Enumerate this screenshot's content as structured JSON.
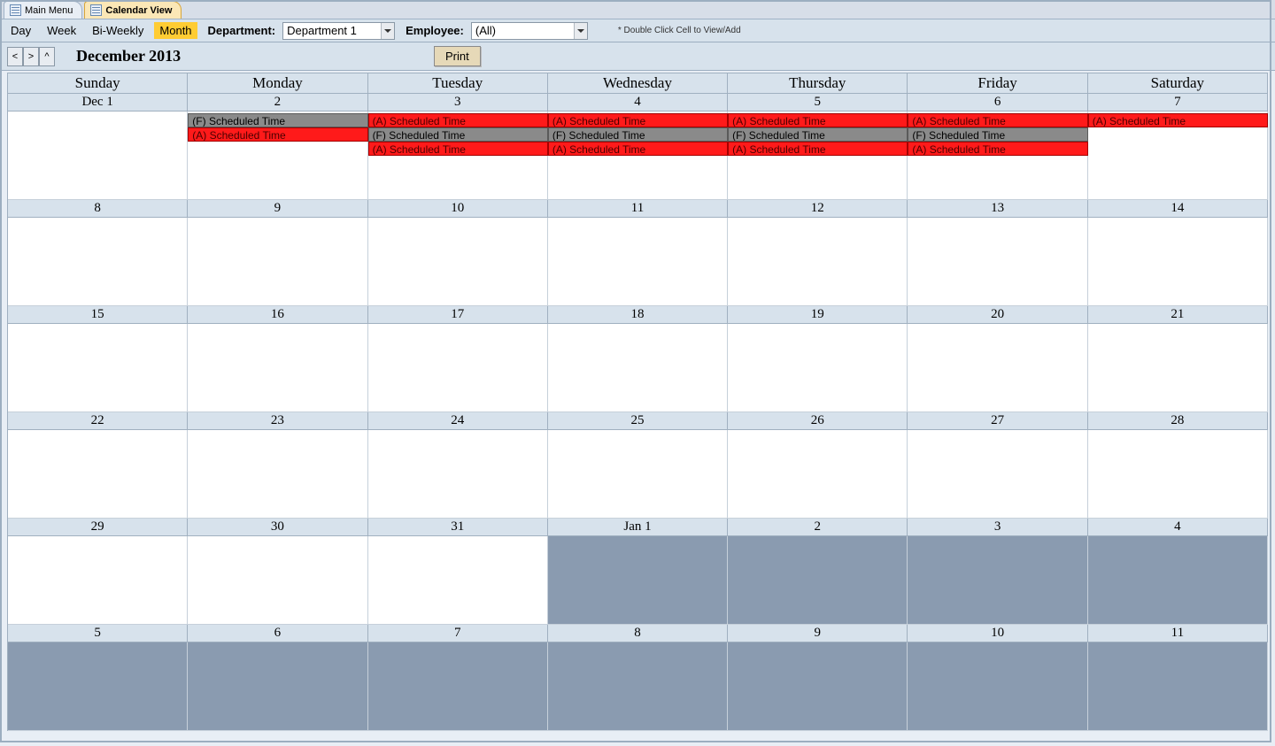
{
  "tabs": [
    {
      "label": "Main Menu",
      "active": false
    },
    {
      "label": "Calendar View",
      "active": true
    }
  ],
  "toolbar": {
    "views": [
      {
        "label": "Day",
        "active": false
      },
      {
        "label": "Week",
        "active": false
      },
      {
        "label": "Bi-Weekly",
        "active": false
      },
      {
        "label": "Month",
        "active": true
      }
    ],
    "department_label": "Department:",
    "department_value": "Department 1",
    "employee_label": "Employee:",
    "employee_value": "(All)",
    "hint": "* Double Click Cell to View/Add"
  },
  "nav": {
    "prev": "<",
    "next": ">",
    "today": "^",
    "month_label": "December 2013",
    "print": "Print"
  },
  "days_of_week": [
    "Sunday",
    "Monday",
    "Tuesday",
    "Wednesday",
    "Thursday",
    "Friday",
    "Saturday"
  ],
  "weeks": [
    {
      "nums": [
        "Dec 1",
        "2",
        "3",
        "4",
        "5",
        "6",
        "7"
      ],
      "other": [
        false,
        false,
        false,
        false,
        false,
        false,
        false
      ]
    },
    {
      "nums": [
        "8",
        "9",
        "10",
        "11",
        "12",
        "13",
        "14"
      ],
      "other": [
        false,
        false,
        false,
        false,
        false,
        false,
        false
      ]
    },
    {
      "nums": [
        "15",
        "16",
        "17",
        "18",
        "19",
        "20",
        "21"
      ],
      "other": [
        false,
        false,
        false,
        false,
        false,
        false,
        false
      ]
    },
    {
      "nums": [
        "22",
        "23",
        "24",
        "25",
        "26",
        "27",
        "28"
      ],
      "other": [
        false,
        false,
        false,
        false,
        false,
        false,
        false
      ]
    },
    {
      "nums": [
        "29",
        "30",
        "31",
        "Jan 1",
        "2",
        "3",
        "4"
      ],
      "other": [
        false,
        false,
        false,
        true,
        true,
        true,
        true
      ]
    },
    {
      "nums": [
        "5",
        "6",
        "7",
        "8",
        "9",
        "10",
        "11"
      ],
      "other": [
        true,
        true,
        true,
        true,
        true,
        true,
        true
      ]
    }
  ],
  "events_week0": [
    {
      "row": 0,
      "start": 1,
      "end": 1,
      "color": "gray",
      "text": "(F) Scheduled Time"
    },
    {
      "row": 0,
      "start": 2,
      "end": 6,
      "color": "red",
      "text": "(A) Scheduled Time",
      "repeat_each_day": true
    },
    {
      "row": 1,
      "start": 1,
      "end": 1,
      "color": "red",
      "text": "(A) Scheduled Time"
    },
    {
      "row": 1,
      "start": 2,
      "end": 5,
      "color": "gray",
      "text": "(F) Scheduled Time",
      "repeat_each_day": true
    },
    {
      "row": 2,
      "start": 2,
      "end": 5,
      "color": "red",
      "text": "(A) Scheduled Time",
      "repeat_each_day": true
    }
  ],
  "cell_heights": {
    "week0": 100,
    "other": 100
  }
}
